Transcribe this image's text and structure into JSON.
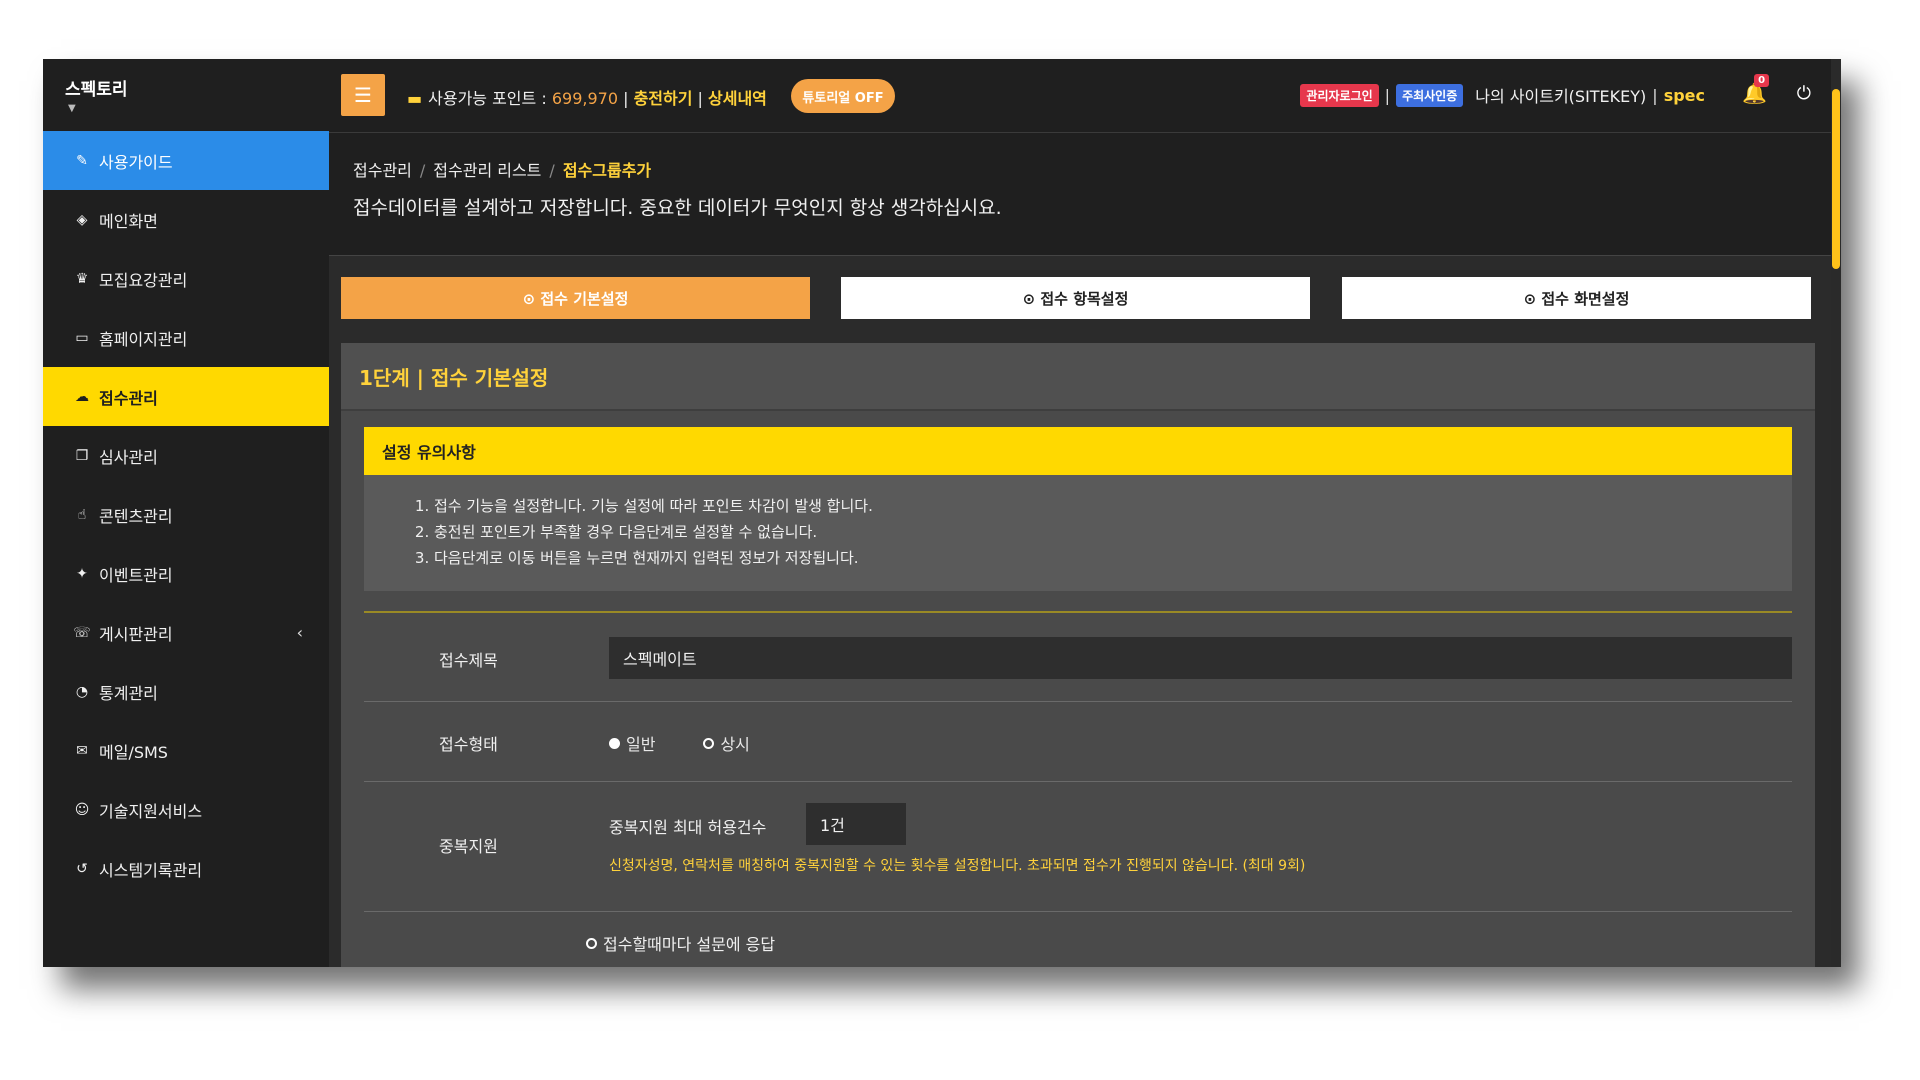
{
  "app": {
    "brand": "스펙토리"
  },
  "sidebar": {
    "items": [
      {
        "label": "사용가이드",
        "icon": "book-icon",
        "glyph": "✎"
      },
      {
        "label": "메인화면",
        "icon": "cube-icon",
        "glyph": "◈"
      },
      {
        "label": "모집요강관리",
        "icon": "trophy-icon",
        "glyph": "♛"
      },
      {
        "label": "홈페이지관리",
        "icon": "monitor-icon",
        "glyph": "▭"
      },
      {
        "label": "접수관리",
        "icon": "cloud-upload-icon",
        "glyph": "☁"
      },
      {
        "label": "심사관리",
        "icon": "copy-icon",
        "glyph": "❐"
      },
      {
        "label": "콘텐츠관리",
        "icon": "thumbs-up-icon",
        "glyph": "☝"
      },
      {
        "label": "이벤트관리",
        "icon": "gift-icon",
        "glyph": "✦"
      },
      {
        "label": "게시판관리",
        "icon": "comments-icon",
        "glyph": "☏",
        "chevron": "‹"
      },
      {
        "label": "통계관리",
        "icon": "pie-chart-icon",
        "glyph": "◔"
      },
      {
        "label": "메일/SMS",
        "icon": "envelope-icon",
        "glyph": "✉"
      },
      {
        "label": "기술지원서비스",
        "icon": "smile-icon",
        "glyph": "☺"
      },
      {
        "label": "시스템기록관리",
        "icon": "history-icon",
        "glyph": "↺"
      }
    ],
    "active_blue": "사용가이드",
    "active_yellow": "접수관리"
  },
  "topbar": {
    "menu_glyph": "☰",
    "points_prefix": "사용가능 포인트 : ",
    "points_value": "699,970",
    "bar": " | ",
    "charge": "충전하기",
    "history": "상세내역",
    "tutorial": "튜토리얼 OFF",
    "admin_badge": "관리자로그인",
    "host_badge": "주최사인증",
    "sitekey_label": "나의 사이트키(SITEKEY)",
    "sitekey_value": "spec",
    "notification_count": "0"
  },
  "breadcrumb": [
    "접수관리",
    "접수관리 리스트",
    "접수그룹추가"
  ],
  "page_description": "접수데이터를 설계하고 저장합니다. 중요한 데이터가 무엇인지 항상 생각하십시요.",
  "steps": [
    "⊙ 접수 기본설정",
    "⊙ 접수 항목설정",
    "⊙ 접수 화면설정"
  ],
  "panel": {
    "title": "1단계 | 접수 기본설정",
    "notice_title": "설정 유의사항",
    "notice_items": [
      "접수 기능을 설정합니다. 기능 설정에 따라 포인트 차감이 발생 합니다.",
      "충전된 포인트가 부족할 경우 다음단계로 설정할 수 없습니다.",
      "다음단계로 이동 버튼을 누르면 현재까지 입력된 정보가 저장됩니다."
    ]
  },
  "form": {
    "title_label": "접수제목",
    "title_value": "스펙메이트",
    "type_label": "접수형태",
    "type_options": [
      "일반",
      "상시"
    ],
    "type_selected": "일반",
    "dup_label": "중복지원",
    "dup_max_label": "중복지원 최대 허용건수",
    "dup_max_value": "1건",
    "dup_help": "신청자성명, 연락처를 매칭하여 중복지원할 수 있는 횟수를 설정합니다. 초과되면 접수가 진행되지 않습니다. (최대 9회)",
    "partial_option": "접수할때마다 설문에 응답"
  },
  "colors": {
    "accent_orange": "#f4a347",
    "accent_yellow": "#ffd900",
    "active_blue": "#2b8ce8",
    "badge_red": "#e6374c",
    "badge_blue": "#3d6fe0"
  }
}
